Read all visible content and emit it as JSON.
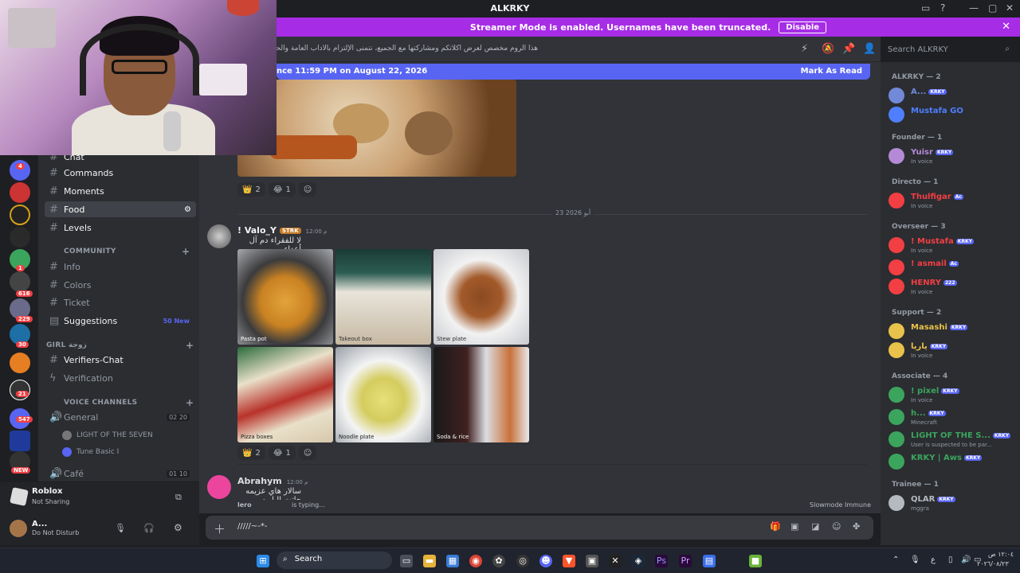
{
  "window": {
    "title": "ALKRKY"
  },
  "banner": {
    "text": "Streamer Mode is enabled. Usernames have been truncated.",
    "disable_label": "Disable"
  },
  "channel_header": {
    "topic": "هذا الروم مخصص لعرض أكلاتكم ومشاركتها مع الجميع، نتمنى الإلتزام بالآداب العامة والحفاظ على جودة المحتوى."
  },
  "search": {
    "placeholder": "Search ALKRKY"
  },
  "new_messages_bar": {
    "text": "nce 11:59 PM on August 22, 2026",
    "mark_read": "Mark As Read"
  },
  "server_rail": {
    "badges": [
      "4",
      "1",
      "616",
      "229",
      "30",
      "21",
      "547",
      "NEW"
    ]
  },
  "channels": {
    "items": [
      {
        "label": "Chat",
        "style": "bright"
      },
      {
        "label": "Commands",
        "style": "bright"
      },
      {
        "label": "Moments",
        "style": "bright"
      },
      {
        "label": "Food",
        "style": "sel"
      },
      {
        "label": "Levels",
        "style": "bright"
      }
    ],
    "community_category": "COMMUNITY",
    "community_items": [
      {
        "label": "Info"
      },
      {
        "label": "Colors"
      },
      {
        "label": "Ticket"
      },
      {
        "label": "Suggestions",
        "badge": "50 New"
      }
    ],
    "girl_category": "Girl زوجة",
    "girl_items": [
      {
        "label": "Verifiers-Chat"
      },
      {
        "label": "Verification"
      }
    ],
    "voice_category": "VOICE CHANNELS",
    "voice_general": {
      "label": "General",
      "count_a": "02",
      "count_b": "20"
    },
    "voice_users": [
      "LIGHT OF THE SEVEN",
      "Tune Basic I"
    ],
    "voice_cafe": {
      "label": "Café",
      "count_a": "01",
      "count_b": "10"
    }
  },
  "activity": {
    "app": "Roblox",
    "status": "Not Sharing"
  },
  "user_panel": {
    "name": "A...",
    "status": "Do Not Disturb"
  },
  "messages": {
    "first_reactions": [
      {
        "emoji": "👑",
        "count": "2"
      },
      {
        "emoji": "😂",
        "count": "1"
      }
    ],
    "date_divider": "23 أبو 2026",
    "post": {
      "author": "! Valo_Y",
      "tag": "STRK",
      "time": "12:00 م",
      "text": "لا للفقراء دم آل أعداء",
      "photo_captions": [
        "Pasta pot",
        "Takeout box",
        "Stew plate",
        "Pizza boxes",
        "Noodle plate",
        "Soda & rice"
      ]
    },
    "second_reactions": [
      {
        "emoji": "👑",
        "count": "2"
      },
      {
        "emoji": "😂",
        "count": "1"
      }
    ],
    "next": {
      "author": "Abrahym",
      "time": "12:00 م",
      "text": "سالار هاي عزيمه جاتت الباريه"
    }
  },
  "typing": {
    "text": "is typing...",
    "who": "lero",
    "slowmode": "Slowmode Immune"
  },
  "composer": {
    "value": "/////~-*-"
  },
  "members": {
    "groups": [
      {
        "role": "ALKRKY — 2",
        "members": [
          {
            "name": "A...",
            "tag": "KRKY",
            "color": "#7289da",
            "sub": ""
          },
          {
            "name": "Mustafa GO",
            "tag": "",
            "color": "#4f7fff",
            "sub": ""
          }
        ]
      },
      {
        "role": "Founder — 1",
        "members": [
          {
            "name": "Yuisr",
            "tag": "KRKY",
            "color": "#b48ad6",
            "sub": "In voice"
          }
        ]
      },
      {
        "role": "Directo — 1",
        "members": [
          {
            "name": "Thulfigar",
            "tag": "Ac",
            "color": "#f23f43",
            "sub": "In voice"
          }
        ]
      },
      {
        "role": "Overseer — 3",
        "members": [
          {
            "name": "! Mustafa",
            "tag": "KRKY",
            "color": "#f23f43",
            "sub": "In voice"
          },
          {
            "name": "! asmail",
            "tag": "Ac",
            "color": "#f23f43",
            "sub": ""
          },
          {
            "name": "HENRY",
            "tag": "222",
            "color": "#f23f43",
            "sub": "In voice"
          }
        ]
      },
      {
        "role": "Support — 2",
        "members": [
          {
            "name": "Masashi",
            "tag": "KRKY",
            "color": "#e8c24a",
            "sub": ""
          },
          {
            "name": "ياريا",
            "tag": "KRKY",
            "color": "#e8c24a",
            "sub": "In voice"
          }
        ]
      },
      {
        "role": "Associate — 4",
        "members": [
          {
            "name": "! pixel",
            "tag": "KRKY",
            "color": "#3ba55d",
            "sub": "In voice"
          },
          {
            "name": "h...",
            "tag": "KRKY",
            "color": "#3ba55d",
            "sub": "Minecraft"
          },
          {
            "name": "LIGHT OF THE S...",
            "tag": "KRKY",
            "color": "#3ba55d",
            "sub": "User is suspected to be par..."
          },
          {
            "name": "KRKY | Aws",
            "tag": "KRKY",
            "color": "#3ba55d",
            "sub": ""
          }
        ]
      },
      {
        "role": "Trainee — 1",
        "members": [
          {
            "name": "QLAR",
            "tag": "KRKY",
            "color": "#b5bac1",
            "sub": "mggra"
          }
        ]
      }
    ]
  },
  "taskbar": {
    "search_label": "Search",
    "time": "١٢:٠٤ ص",
    "date": "٢٠٢٦/٠٨/٢٣",
    "lang": "ع"
  }
}
